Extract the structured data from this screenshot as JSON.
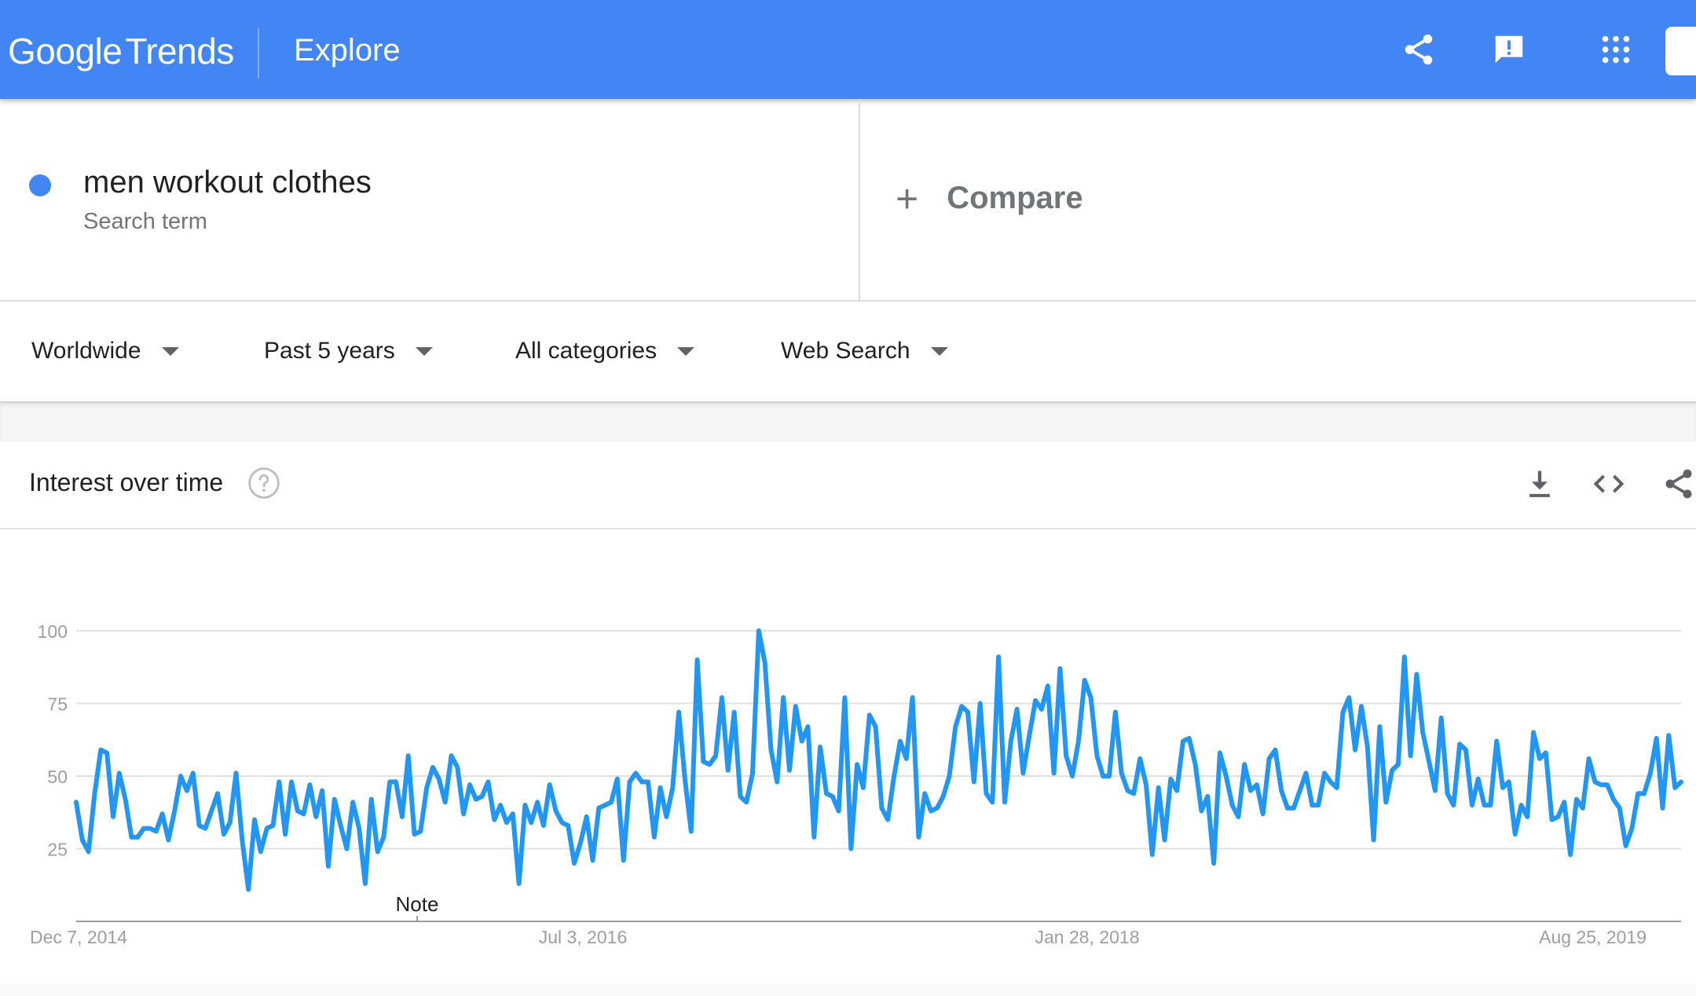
{
  "header": {
    "logo_google": "Google",
    "logo_trends": "Trends",
    "section_title": "Explore",
    "icons": [
      "share-icon",
      "feedback-icon",
      "apps-grid-icon"
    ],
    "color": "#4285f4"
  },
  "search_term": {
    "name": "men workout clothes",
    "type_label": "Search term",
    "color": "#4285f4"
  },
  "compare": {
    "plus": "+",
    "label": "Compare"
  },
  "filters": {
    "region": "Worldwide",
    "time": "Past 5 years",
    "category": "All categories",
    "property": "Web Search"
  },
  "card": {
    "title": "Interest over time",
    "icons": [
      "help-icon",
      "download-icon",
      "embed-icon",
      "share-icon"
    ]
  },
  "chart_data": {
    "type": "line",
    "title": "",
    "xlabel": "",
    "ylabel": "",
    "ylim": [
      0,
      100
    ],
    "yticks": [
      "25",
      "50",
      "75",
      "100"
    ],
    "xticks": [
      "Dec 7, 2014",
      "Jul 3, 2016",
      "Jan 28, 2018",
      "Aug 25, 2019"
    ],
    "annotation": "Note",
    "grid": true,
    "series": [
      {
        "color": "#2196f3",
        "values": [
          41,
          28,
          24,
          44,
          59,
          58,
          36,
          51,
          42,
          29,
          29,
          32,
          32,
          31,
          37,
          28,
          38,
          50,
          45,
          51,
          33,
          32,
          38,
          44,
          30,
          34,
          51,
          28,
          11,
          35,
          24,
          32,
          33,
          48,
          30,
          48,
          38,
          37,
          47,
          36,
          45,
          19,
          42,
          33,
          25,
          41,
          32,
          13,
          42,
          24,
          29,
          48,
          48,
          36,
          57,
          30,
          31,
          46,
          53,
          49,
          41,
          57,
          53,
          37,
          47,
          42,
          43,
          48,
          35,
          40,
          34,
          37,
          13,
          40,
          34,
          41,
          33,
          47,
          38,
          34,
          33,
          20,
          27,
          36,
          21,
          39,
          40,
          41,
          49,
          21,
          48,
          51,
          48,
          48,
          29,
          46,
          36,
          46,
          72,
          49,
          31,
          90,
          55,
          54,
          57,
          77,
          52,
          72,
          43,
          41,
          51,
          100,
          89,
          59,
          48,
          77,
          52,
          74,
          62,
          67,
          29,
          60,
          44,
          43,
          38,
          77,
          25,
          54,
          46,
          71,
          67,
          39,
          35,
          50,
          62,
          56,
          77,
          29,
          44,
          38,
          39,
          43,
          50,
          67,
          74,
          72,
          48,
          75,
          44,
          41,
          91,
          41,
          62,
          73,
          51,
          64,
          76,
          73,
          81,
          51,
          87,
          57,
          50,
          62,
          83,
          77,
          57,
          50,
          50,
          72,
          51,
          45,
          44,
          56,
          47,
          23,
          46,
          28,
          49,
          45,
          62,
          63,
          54,
          38,
          43,
          20,
          58,
          50,
          40,
          36,
          54,
          45,
          47,
          37,
          56,
          59,
          45,
          39,
          39,
          45,
          51,
          40,
          40,
          51,
          48,
          46,
          72,
          77,
          59,
          74,
          60,
          28,
          67,
          41,
          52,
          54,
          91,
          57,
          85,
          65,
          55,
          45,
          70,
          44,
          40,
          61,
          59,
          40,
          49,
          40,
          40,
          62,
          46,
          48,
          30,
          40,
          36,
          65,
          56,
          58,
          35,
          36,
          41,
          23,
          42,
          39,
          56,
          48,
          47,
          47,
          42,
          39,
          26,
          32,
          44,
          44,
          51,
          63,
          39,
          64,
          46,
          48
        ]
      }
    ]
  }
}
